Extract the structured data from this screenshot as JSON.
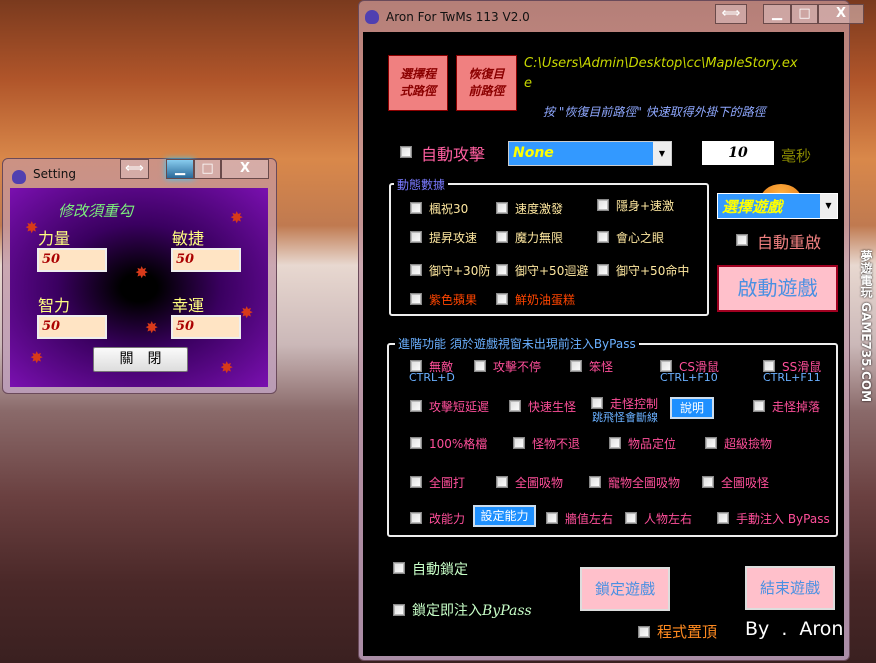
{
  "watermark": "夢遊電玩 GAME735.COM",
  "main": {
    "title": "Aron For TwMs 113  V2.0",
    "controls": {
      "restore": "⟺",
      "minimize": "▁",
      "maximize": "□",
      "close": "X"
    },
    "select_path_button": "選擇程式路徑",
    "restore_path_button": "恢復目前路徑",
    "path_line1": "C:\\Users\\Admin\\Desktop\\cc\\MapleStory.ex",
    "path_line2": "e",
    "hint": "按 \"恢復目前路徑\" 快速取得外掛下的路徑",
    "auto_attack": "自動攻擊",
    "attack_key_select": "None",
    "interval_value": "10",
    "interval_unit": "毫秒",
    "select_game": "選擇遊戲",
    "auto_restart": "自動重啟",
    "start_game": "啟動遊戲",
    "dynamic_group": {
      "title": "動態數據",
      "items": [
        "楓祝30",
        "速度激發",
        "隱身+速激",
        "提昇攻速",
        "魔力無限",
        "會心之眼",
        "御守+30防",
        "御守+50迴避",
        "御守+50命中",
        "紫色蘋果",
        "鮮奶油蛋糕"
      ]
    },
    "advanced_group": {
      "title": "進階功能 須於遊戲視窗未出現前注入ByPass",
      "items": [
        "無敵",
        "攻擊不停",
        "笨怪",
        "CS滑鼠",
        "SS滑鼠",
        "攻擊短延遲",
        "快速生怪",
        "走怪控制",
        "走怪掉落",
        "100%格檔",
        "怪物不退",
        "物品定位",
        "超級撿物",
        "全圖打",
        "全圖吸物",
        "寵物全圖吸物",
        "全圖吸怪",
        "改能力",
        "牆值左右",
        "人物左右",
        "手動注入 ByPass"
      ],
      "hotkeys": [
        "CTRL+D",
        "CTRL+F10",
        "CTRL+F11"
      ],
      "note": "跳飛怪會斷線",
      "explain_button": "說明",
      "set_stats_button": "設定能力"
    },
    "auto_lock": "自動鎖定",
    "lock_inject": "鎖定即注入",
    "lock_inject_bypass": "ByPass",
    "lock_game": "鎖定遊戲",
    "end_game": "結束遊戲",
    "always_on_top": "程式置頂",
    "credit": "By . Aron",
    "colors": {
      "accent_blue": "#3399ff",
      "pink_button": "#ffc0cb",
      "path_text": "#c8d800"
    }
  },
  "setting": {
    "title": "Setting",
    "controls": {
      "restore": "⟺",
      "minimize": "▁",
      "maximize": "□",
      "close": "X"
    },
    "note": "修改須重勾",
    "str_label": "力量",
    "str_value": "50",
    "dex_label": "敏捷",
    "dex_value": "50",
    "int_label": "智力",
    "int_value": "50",
    "luk_label": "幸運",
    "luk_value": "50",
    "close_button": "關　閉"
  }
}
